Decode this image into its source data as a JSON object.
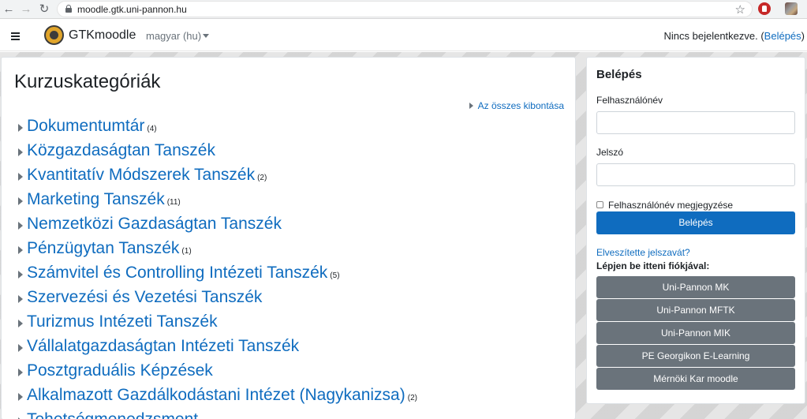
{
  "browser": {
    "url": "moodle.gtk.uni-pannon.hu",
    "back_glyph": "←",
    "forward_glyph": "→",
    "reload_glyph": "↻",
    "star_glyph": "☆"
  },
  "navbar": {
    "site_name": "GTKmoodle",
    "language": "magyar (hu)",
    "login_status_text": "Nincs bejelentkezve. (",
    "login_link": "Belépés",
    "login_status_close": ")"
  },
  "main": {
    "title": "Kurzuskategóriák",
    "expand_all": "Az összes kibontása",
    "categories": [
      {
        "name": "Dokumentumtár",
        "count": "(4)"
      },
      {
        "name": "Közgazdaságtan Tanszék",
        "count": ""
      },
      {
        "name": "Kvantitatív Módszerek Tanszék",
        "count": "(2)"
      },
      {
        "name": "Marketing Tanszék",
        "count": "(11)"
      },
      {
        "name": "Nemzetközi Gazdaságtan Tanszék",
        "count": ""
      },
      {
        "name": "Pénzügytan Tanszék",
        "count": "(1)"
      },
      {
        "name": "Számvitel és Controlling Intézeti Tanszék",
        "count": "(5)"
      },
      {
        "name": "Szervezési és Vezetési Tanszék",
        "count": ""
      },
      {
        "name": "Turizmus Intézeti Tanszék",
        "count": ""
      },
      {
        "name": "Vállalatgazdaságtan Intézeti Tanszék",
        "count": ""
      },
      {
        "name": "Posztgraduális Képzések",
        "count": ""
      },
      {
        "name": "Alkalmazott Gazdálkodástani Intézet (Nagykanizsa)",
        "count": "(2)"
      },
      {
        "name": "Tehetségmenedzsment",
        "count": ""
      }
    ]
  },
  "login_block": {
    "title": "Belépés",
    "username_label": "Felhasználónév",
    "username_value": "",
    "password_label": "Jelszó",
    "password_value": "",
    "remember_label": "Felhasználónév megjegyzése",
    "submit_label": "Belépés",
    "forgot_link": "Elveszítette jelszavát?",
    "other_accounts_label": "Lépjen be itteni fiókjával:",
    "sso_buttons": [
      "Uni-Pannon MK",
      "Uni-Pannon MFTK",
      "Uni-Pannon MIK",
      "PE Georgikon E-Learning",
      "Mérnöki Kar moodle"
    ]
  },
  "colors": {
    "link": "#0f6cbf",
    "primary_button": "#0f6cbf",
    "sso_button": "#6a737b"
  }
}
